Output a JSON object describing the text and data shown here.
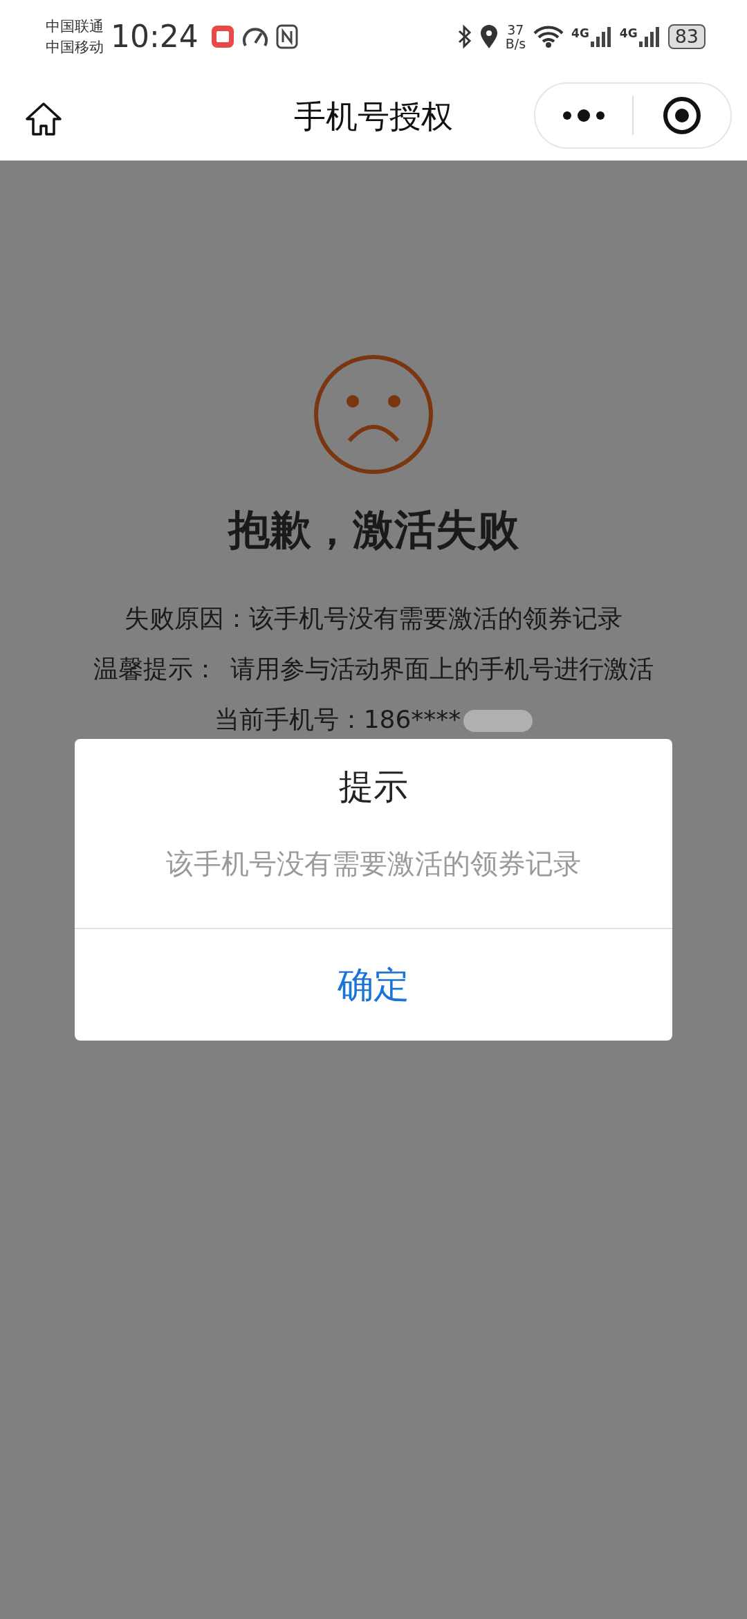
{
  "status_bar": {
    "carriers": [
      "中国联通",
      "中国移动"
    ],
    "time": "10:24",
    "network_speed": [
      "37",
      "B/s"
    ],
    "signal_labels": [
      "4G",
      "4G"
    ],
    "battery": "83"
  },
  "nav_bar": {
    "title": "手机号授权"
  },
  "result": {
    "title": "抱歉，激活失败",
    "lines": [
      {
        "label": "失败原因：",
        "text": "该手机号没有需要激活的领券记录"
      },
      {
        "label": "温馨提示：",
        "text": "请用参与活动界面上的手机号进行激活"
      },
      {
        "label": "当前手机号：",
        "text": "186****"
      }
    ]
  },
  "dialog": {
    "title": "提示",
    "message": "该手机号没有需要激活的领券记录",
    "button": "确定"
  }
}
